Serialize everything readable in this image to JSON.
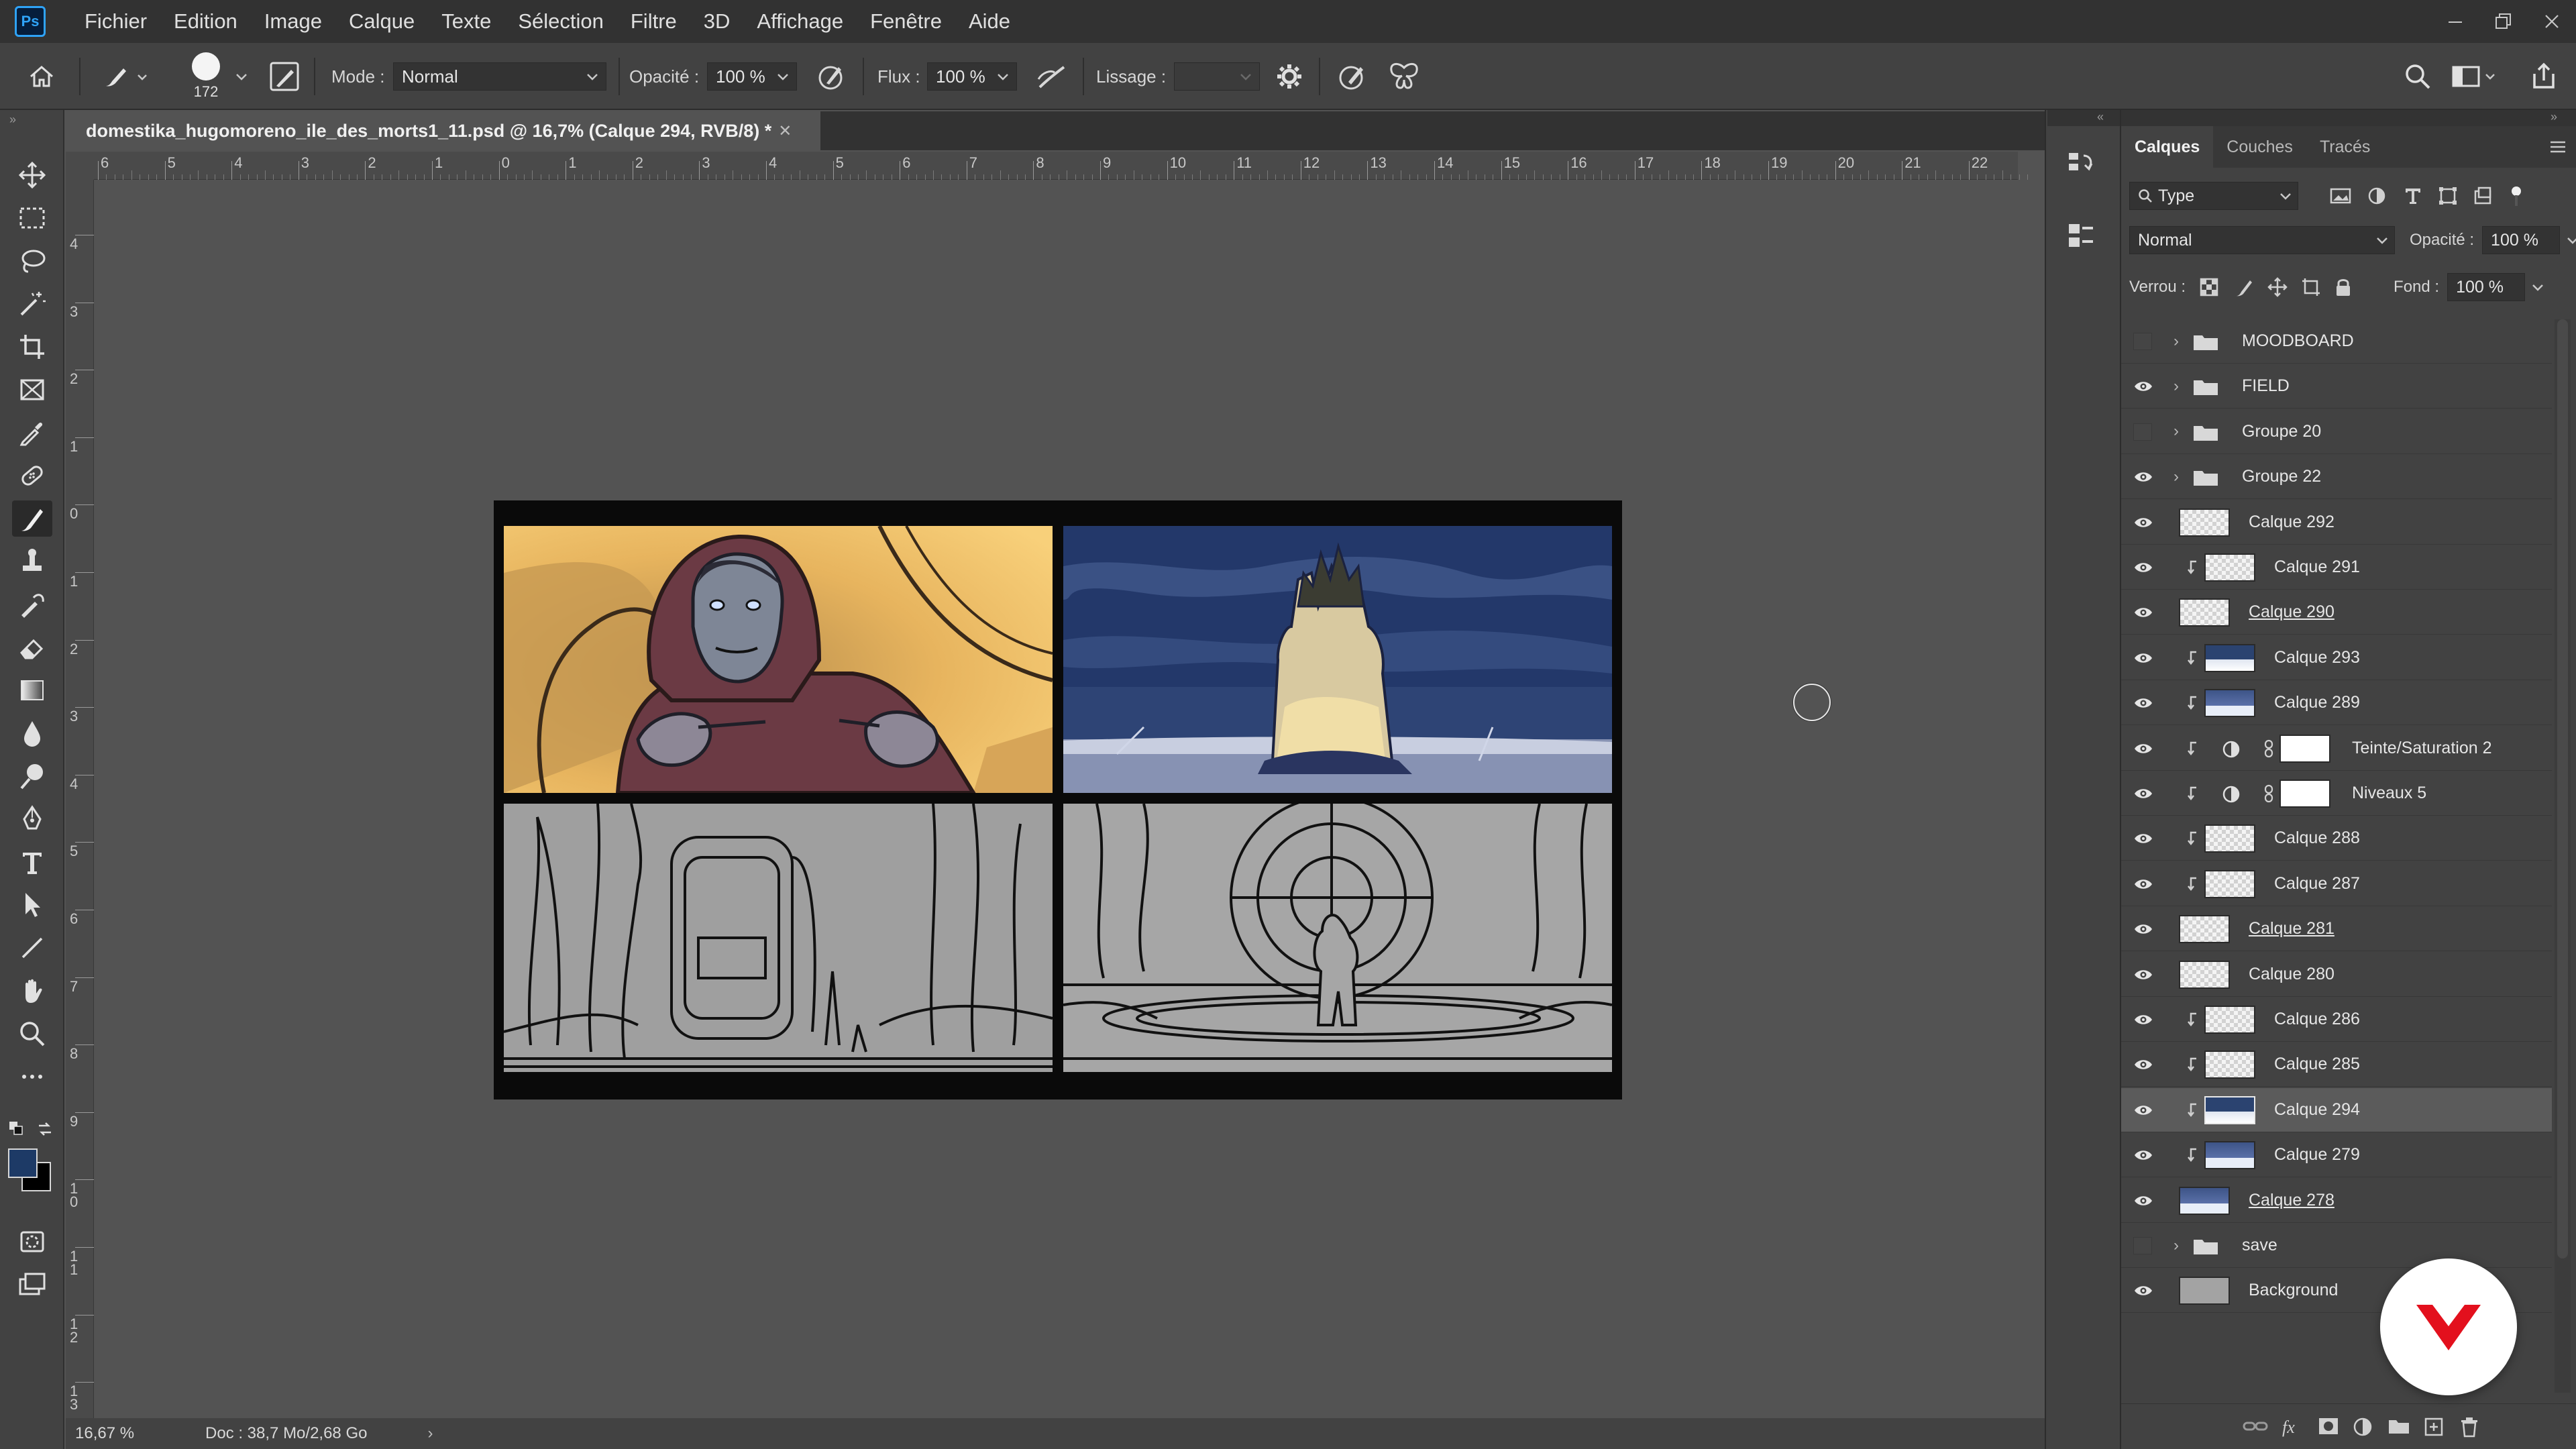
{
  "app": {
    "logo_text": "Ps"
  },
  "menu": [
    "Fichier",
    "Edition",
    "Image",
    "Calque",
    "Texte",
    "Sélection",
    "Filtre",
    "3D",
    "Affichage",
    "Fenêtre",
    "Aide"
  ],
  "options": {
    "brush_size": "172",
    "mode_label": "Mode :",
    "mode_value": "Normal",
    "opacity_label": "Opacité :",
    "opacity_value": "100 %",
    "flow_label": "Flux :",
    "flow_value": "100 %",
    "smoothing_label": "Lissage :",
    "smoothing_value": ""
  },
  "document": {
    "tab_title": "domestika_hugomoreno_ile_des_morts1_11.psd @ 16,7% (Calque 294, RVB/8) *",
    "zoom": "16,67 %",
    "doc_info": "Doc : 38,7 Mo/2,68 Go",
    "status_arrow": "›"
  },
  "rulers": {
    "top": [
      "6",
      "5",
      "4",
      "3",
      "2",
      "1",
      "0",
      "1",
      "2",
      "3",
      "4",
      "5",
      "6",
      "7",
      "8",
      "9",
      "10",
      "11",
      "12",
      "13",
      "14",
      "15",
      "16",
      "17",
      "18",
      "19",
      "20",
      "21",
      "22"
    ],
    "left": [
      "4",
      "3",
      "2",
      "1",
      "0",
      "1",
      "2",
      "3",
      "4",
      "5",
      "6",
      "7",
      "8",
      "9",
      "10",
      "11",
      "12",
      "13"
    ]
  },
  "panel": {
    "tabs": [
      "Calques",
      "Couches",
      "Tracés"
    ],
    "filter_value": "Type",
    "blend_mode": "Normal",
    "opacity_label": "Opacité :",
    "opacity_value": "100 %",
    "lock_label": "Verrou :",
    "fill_label": "Fond :",
    "fill_value": "100 %"
  },
  "layers": [
    {
      "name": "MOODBOARD",
      "kind": "group",
      "visible": false,
      "clipped": false
    },
    {
      "name": "FIELD",
      "kind": "group",
      "visible": true,
      "clipped": false
    },
    {
      "name": "Groupe 20",
      "kind": "group",
      "visible": false,
      "clipped": false
    },
    {
      "name": "Groupe 22",
      "kind": "group",
      "visible": true,
      "clipped": false
    },
    {
      "name": "Calque 292",
      "kind": "layer",
      "visible": true,
      "clipped": false
    },
    {
      "name": "Calque 291",
      "kind": "layer",
      "visible": true,
      "clipped": true
    },
    {
      "name": "Calque 290",
      "kind": "layer",
      "visible": true,
      "clipped": false
    },
    {
      "name": "Calque 293",
      "kind": "layer",
      "visible": true,
      "clipped": true
    },
    {
      "name": "Calque 289",
      "kind": "layer",
      "visible": true,
      "clipped": true
    },
    {
      "name": "Teinte/Saturation 2",
      "kind": "adjustment",
      "visible": true,
      "clipped": true
    },
    {
      "name": "Niveaux 5",
      "kind": "adjustment",
      "visible": true,
      "clipped": true
    },
    {
      "name": "Calque 288",
      "kind": "layer",
      "visible": true,
      "clipped": true
    },
    {
      "name": "Calque 287",
      "kind": "layer",
      "visible": true,
      "clipped": true
    },
    {
      "name": "Calque 281",
      "kind": "layer",
      "visible": true,
      "clipped": false
    },
    {
      "name": "Calque 280",
      "kind": "layer",
      "visible": true,
      "clipped": false
    },
    {
      "name": "Calque 286",
      "kind": "layer",
      "visible": true,
      "clipped": true
    },
    {
      "name": "Calque 285",
      "kind": "layer",
      "visible": true,
      "clipped": true
    },
    {
      "name": "Calque 294",
      "kind": "layer",
      "visible": true,
      "clipped": true,
      "selected": true
    },
    {
      "name": "Calque 279",
      "kind": "layer",
      "visible": true,
      "clipped": true
    },
    {
      "name": "Calque 278",
      "kind": "layer",
      "visible": true,
      "clipped": false
    },
    {
      "name": "save",
      "kind": "group",
      "visible": false,
      "clipped": false
    },
    {
      "name": "Background",
      "kind": "layer",
      "visible": true,
      "clipped": false
    }
  ],
  "colors": {
    "foreground": "#1d3a66",
    "background": "#000000",
    "accent_blue": "#2fa3f7",
    "domestika_red": "#e3101d"
  }
}
